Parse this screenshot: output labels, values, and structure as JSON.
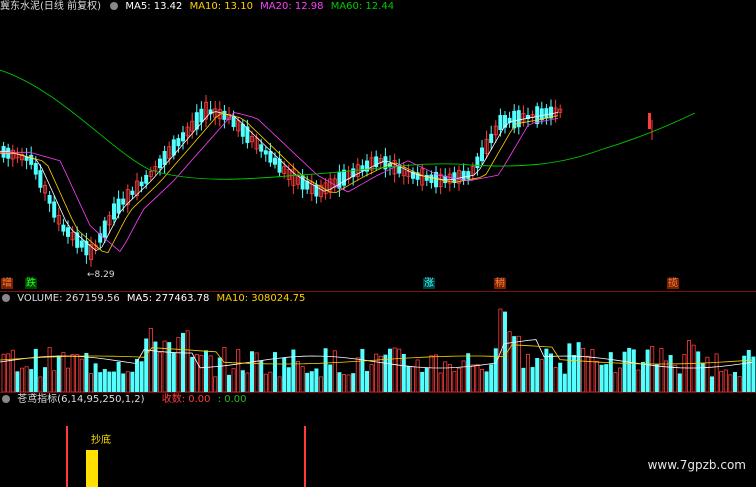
{
  "price_header": {
    "title": "冀东水泥(日线 前复权)",
    "ma5_label": "MA5: 13.42",
    "ma10_label": "MA10: 13.10",
    "ma20_label": "MA20: 12.98",
    "ma60_label": "MA60: 12.44"
  },
  "price_tags": {
    "zeng": "增",
    "die": "跌",
    "zhang": "涨",
    "fu": "稍",
    "jie": "揽"
  },
  "low_annotation": "8.29",
  "volume_header": {
    "label": "VOLUME: 267159.56",
    "ma5": "MA5: 277463.78",
    "ma10": "MA10: 308024.75"
  },
  "indicator_header": {
    "label": "苍鸢指标(6,14,95,250,1,2)",
    "shoushou": "收数: 0.00",
    "value2": ": 0.00"
  },
  "indicator_signal_text": "抄底",
  "watermark": "www.7gpzb.com",
  "colors": {
    "up": "#ff3c3c",
    "down": "#54ffff",
    "ma5": "#ffffff",
    "ma10": "#ffd200",
    "ma20": "#ff40ff",
    "ma60": "#00c800",
    "signal_bar": "#ffe000"
  },
  "chart_data": [
    {
      "type": "candlestick",
      "title": "冀东水泥(日线 前复权)",
      "series": [
        {
          "name": "MA5",
          "values": [
            13.42
          ]
        },
        {
          "name": "MA10",
          "values": [
            13.1
          ]
        },
        {
          "name": "MA20",
          "values": [
            12.98
          ]
        },
        {
          "name": "MA60",
          "values": [
            12.44
          ]
        }
      ],
      "annotations": [
        "8.29"
      ]
    },
    {
      "type": "bar",
      "title": "VOLUME: 267159.56",
      "series": [
        {
          "name": "MA5",
          "values": [
            277463.78
          ]
        },
        {
          "name": "MA10",
          "values": [
            308024.75
          ]
        }
      ]
    },
    {
      "type": "bar",
      "title": "苍鸢指标(6,14,95,250,1,2)",
      "annotations": [
        "抄底"
      ]
    }
  ]
}
